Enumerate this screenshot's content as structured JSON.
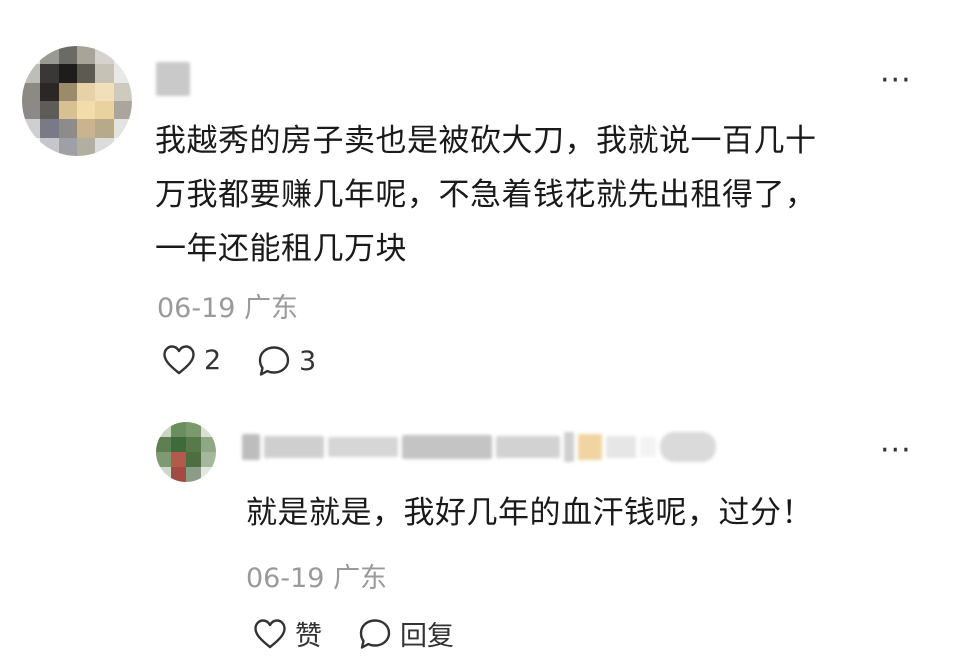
{
  "comment": {
    "text_line1": "我越秀的房子卖也是被砍大刀，我就说一百几十",
    "text_line2": "万我都要赚几年呢，不急着钱花就先出租得了，",
    "text_line3": "一年还能租几万块",
    "date": "06-19",
    "location": "广东",
    "likes": "2",
    "replies": "3",
    "more": "···"
  },
  "reply": {
    "text": "就是就是，我好几年的血汗钱呢，过分！",
    "date": "06-19",
    "location": "广东",
    "like_label": "赞",
    "reply_label": "回复",
    "more": "···"
  },
  "colors": {
    "text": "#1a1a1a",
    "meta": "#9a9a9a",
    "icon": "#333333"
  }
}
